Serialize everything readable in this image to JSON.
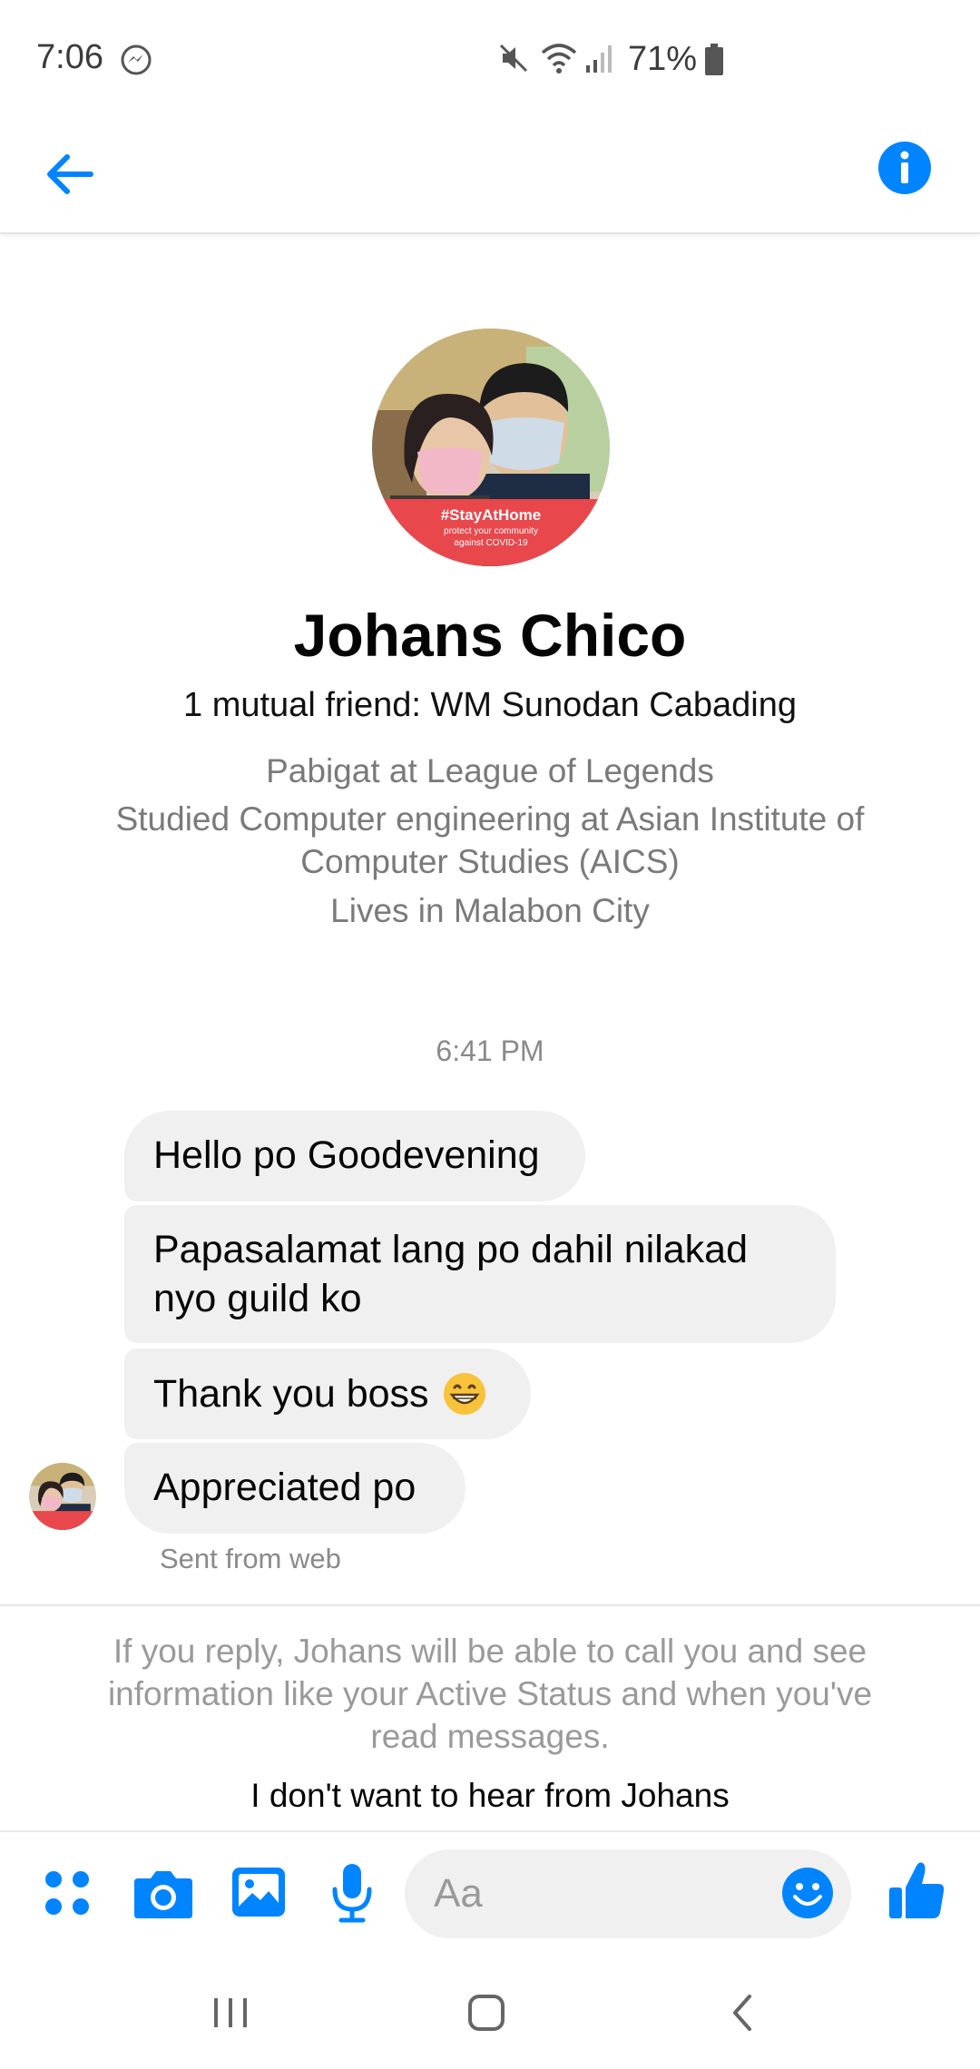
{
  "status_bar": {
    "time": "7:06",
    "battery": "71%"
  },
  "header": {
    "back_icon": "back-arrow-icon",
    "info_icon": "info-icon"
  },
  "profile": {
    "name": "Johans Chico",
    "mutual": "1 mutual friend: WM Sunodan Cabading",
    "work": "Pabigat at League of Legends",
    "education_line1": "Studied Computer engineering at Asian Institute of",
    "education_line2": "Computer Studies (AICS)",
    "location": "Lives in Malabon City",
    "avatar_banner": "#StayAtHome",
    "avatar_banner_sub": "protect your community",
    "avatar_banner_sub2": "against COVID-19"
  },
  "chat": {
    "timestamp": "6:41 PM",
    "messages": [
      {
        "line1": "Hello po Goodevening"
      },
      {
        "line1": "Papasalamat lang po dahil nilakad",
        "line2": "nyo guild ko"
      },
      {
        "line1": "Thank you boss"
      },
      {
        "line1": "Appreciated po"
      }
    ],
    "sent_note": "Sent from web"
  },
  "notice": {
    "line1": "If you reply, Johans will be able to call you and see",
    "line2": "information like your Active Status and when you've",
    "line3": "read messages.",
    "block_link": "I don't want to hear from Johans"
  },
  "composer": {
    "placeholder": "Aa",
    "icons": [
      "apps-icon",
      "camera-icon",
      "gallery-icon",
      "microphone-icon",
      "emoji-icon",
      "thumbs-up-icon"
    ]
  },
  "colors": {
    "accent": "#0084ff",
    "bubble": "#f0f0f0",
    "banner": "#e8474c"
  }
}
